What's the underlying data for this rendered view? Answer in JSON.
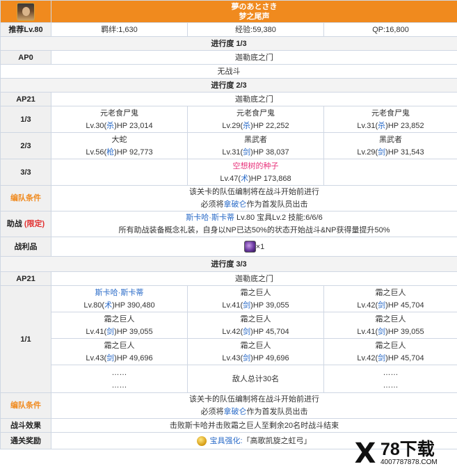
{
  "header": {
    "title_jp": "夢のあとさき",
    "title_cn": "梦之尾声",
    "rec_label": "推荐Lv.80",
    "bond": "羁绊:1,630",
    "exp": "经验:59,380",
    "qp": "QP:16,800"
  },
  "progress1": {
    "title": "进行度 1/3",
    "ap_label": "AP0",
    "location": "迦勒底之门",
    "note": "无战斗"
  },
  "progress2": {
    "title": "进行度 2/3",
    "ap_label": "AP21",
    "location": "迦勒底之门",
    "waves": [
      {
        "label": "1/3",
        "enemies": [
          {
            "name": "元老食尸鬼",
            "lv": "Lv.30(",
            "cls": "杀",
            "hp": ")HP 23,014"
          },
          {
            "name": "元老食尸鬼",
            "lv": "Lv.29(",
            "cls": "杀",
            "hp": ")HP 22,252"
          },
          {
            "name": "元老食尸鬼",
            "lv": "Lv.31(",
            "cls": "杀",
            "hp": ")HP 23,852"
          }
        ]
      },
      {
        "label": "2/3",
        "enemies": [
          {
            "name": "大蛇",
            "lv": "Lv.56(",
            "cls": "枪",
            "hp": ")HP 92,773"
          },
          {
            "name": "黑武者",
            "lv": "Lv.31(",
            "cls": "剑",
            "hp": ")HP 38,037"
          },
          {
            "name": "黑武者",
            "lv": "Lv.29(",
            "cls": "剑",
            "hp": ")HP 31,543"
          }
        ]
      },
      {
        "label": "3/3",
        "enemy": {
          "name": "空想树的种子",
          "lv": "Lv.47(",
          "cls": "术",
          "hp": ")HP 173,868"
        }
      }
    ],
    "formation_label": "编队条件",
    "formation_lines": [
      "该关卡的队伍编制将在战斗开始前进行",
      "必须将",
      "拿破仑",
      "作为首发队员出击"
    ],
    "support_label": "助战",
    "support_tag": "(限定)",
    "support_line1_name": "斯卡哈·斯卡蒂",
    "support_line1_rest": " Lv.80 宝具Lv.2 技能:6/6/6",
    "support_line2": "所有助战装备概念礼装，自身以NP已达50%的状态开始战斗&NP获得量提升50%",
    "loot_label": "战利品",
    "loot_count": "×1"
  },
  "progress3": {
    "title": "进行度 3/3",
    "ap_label": "AP21",
    "location": "迦勒底之门",
    "wave_label": "1/1",
    "rows": [
      [
        {
          "name": "斯卡哈·斯卡蒂",
          "lv": "Lv.80(",
          "cls": "术",
          "hp": ")HP 390,480",
          "blue": true
        },
        {
          "name": "霜之巨人",
          "lv": "Lv.41(",
          "cls": "剑",
          "hp": ")HP 39,055"
        },
        {
          "name": "霜之巨人",
          "lv": "Lv.42(",
          "cls": "剑",
          "hp": ")HP 45,704"
        }
      ],
      [
        {
          "name": "霜之巨人",
          "lv": "Lv.41(",
          "cls": "剑",
          "hp": ")HP 39,055"
        },
        {
          "name": "霜之巨人",
          "lv": "Lv.42(",
          "cls": "剑",
          "hp": ")HP 45,704"
        },
        {
          "name": "霜之巨人",
          "lv": "Lv.41(",
          "cls": "剑",
          "hp": ")HP 39,055"
        }
      ],
      [
        {
          "name": "霜之巨人",
          "lv": "Lv.43(",
          "cls": "剑",
          "hp": ")HP 49,696"
        },
        {
          "name": "霜之巨人",
          "lv": "Lv.43(",
          "cls": "剑",
          "hp": ")HP 49,696"
        },
        {
          "name": "霜之巨人",
          "lv": "Lv.42(",
          "cls": "剑",
          "hp": ")HP 45,704"
        }
      ]
    ],
    "dots": "……",
    "total": "敌人总计30名",
    "formation_label": "编队条件",
    "formation_lines": [
      "该关卡的队伍编制将在战斗开始前进行",
      "必须将",
      "拿破仑",
      "作为首发队员出击"
    ],
    "effect_label": "战斗效果",
    "effect": "击败斯卡哈并击败霜之巨人至剩余20名时战斗结束",
    "reward_label": "通关奖励",
    "reward_link": "宝具强化:",
    "reward_rest": "「高歌凯旋之虹弓」"
  },
  "watermark": {
    "x": "X",
    "title": "78下载",
    "url": "4007787878.COM"
  },
  "icons": {
    "avatar": "servant-avatar-icon",
    "gem": "purple-gem-icon",
    "grail": "gold-grail-icon"
  }
}
